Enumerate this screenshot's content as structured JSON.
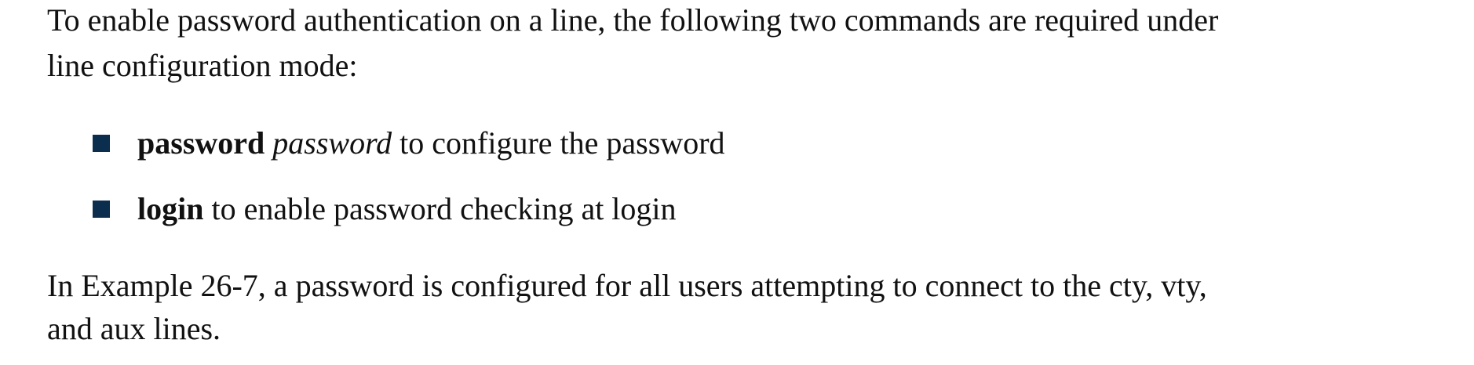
{
  "intro": {
    "line1": "To enable password authentication on a line, the following two commands are required under",
    "line2": "line configuration mode:"
  },
  "bullets": [
    {
      "command": "password",
      "argument": "password",
      "description": "to configure the password"
    },
    {
      "command": "login",
      "description": "to enable password checking at login"
    }
  ],
  "outro": {
    "line1": "In Example 26-7, a password is configured for all users attempting to connect to the cty, vty,",
    "line2": "and aux lines."
  },
  "colors": {
    "bullet": "#0b2d4e"
  }
}
